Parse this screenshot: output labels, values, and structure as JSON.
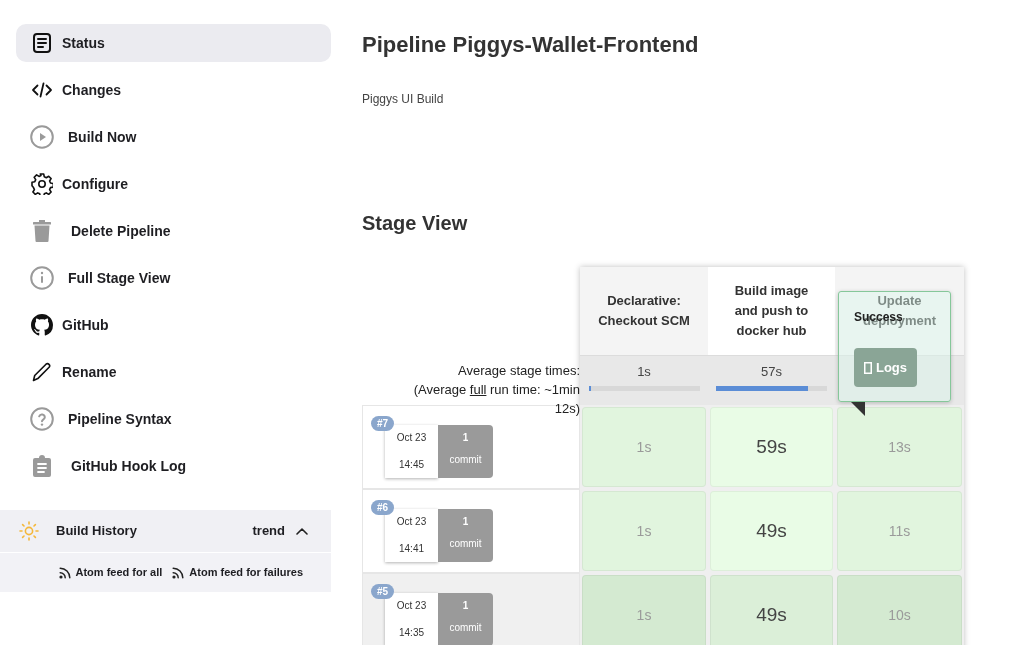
{
  "sidebar": {
    "items": [
      {
        "label": "Status",
        "selected": true
      },
      {
        "label": "Changes",
        "selected": false
      },
      {
        "label": "Build Now",
        "selected": false
      },
      {
        "label": "Configure",
        "selected": false
      },
      {
        "label": "Delete Pipeline",
        "selected": false
      },
      {
        "label": "Full Stage View",
        "selected": false
      },
      {
        "label": "GitHub",
        "selected": false
      },
      {
        "label": "Rename",
        "selected": false
      },
      {
        "label": "Pipeline Syntax",
        "selected": false
      },
      {
        "label": "GitHub Hook Log",
        "selected": false
      }
    ]
  },
  "build_history": {
    "title": "Build History",
    "trend": "trend",
    "expanded": true,
    "feeds": [
      "Atom feed for all",
      "Atom feed for failures"
    ]
  },
  "page": {
    "title": "Pipeline Piggys-Wallet-Frontend",
    "description": "Piggys UI Build",
    "section_heading": "Stage View"
  },
  "stage_view": {
    "average_label": "Average stage times:",
    "full_run_time": {
      "before": "(Average",
      "link": "full",
      "after": "run time: ~1min 12s)"
    },
    "columns": [
      {
        "name": "Declarative: Checkout SCM",
        "average": "1s",
        "level": 0.02,
        "highlighted": false
      },
      {
        "name": "Build image and push to docker hub",
        "average": "57s",
        "level": 0.83,
        "highlighted": true
      },
      {
        "name": "Update deployment",
        "highlighted": false
      }
    ],
    "builds": [
      {
        "number": "#7",
        "date": "Oct 23",
        "time": "14:45",
        "commits": "1",
        "commit_label": "commit",
        "hovered": false,
        "durations": [
          "1s",
          "59s",
          "13s"
        ]
      },
      {
        "number": "#6",
        "date": "Oct 23",
        "time": "14:41",
        "commits": "1",
        "commit_label": "commit",
        "hovered": false,
        "durations": [
          "1s",
          "49s",
          "11s"
        ]
      },
      {
        "number": "#5",
        "date": "Oct 23",
        "time": "14:35",
        "commits": "1",
        "commit_label": "commit",
        "hovered": true,
        "durations": [
          "1s",
          "49s",
          "10s"
        ]
      }
    ],
    "popover": {
      "status": "Success",
      "button": "Logs"
    }
  }
}
